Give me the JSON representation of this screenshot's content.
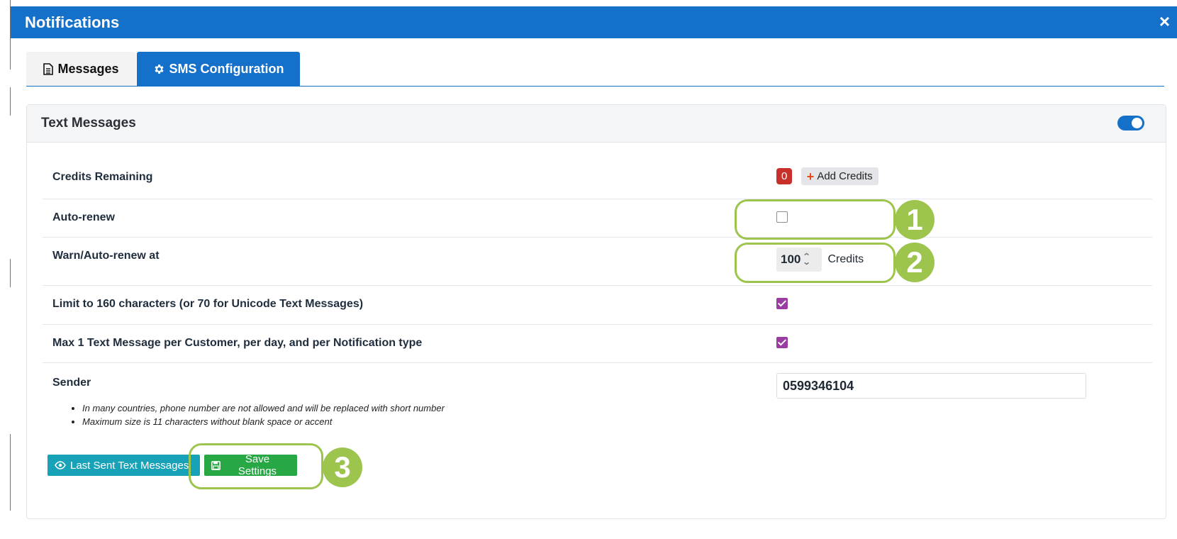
{
  "dialog": {
    "title": "Notifications",
    "close_label": "×"
  },
  "tabs": [
    {
      "label": "Messages",
      "icon": "document-icon",
      "active": false
    },
    {
      "label": "SMS Configuration",
      "icon": "gear-icon",
      "active": true
    }
  ],
  "card": {
    "title": "Text Messages",
    "enabled": true
  },
  "rows": {
    "credits_remaining": {
      "label": "Credits Remaining",
      "count": "0",
      "add_label": "Add Credits"
    },
    "auto_renew": {
      "label": "Auto-renew",
      "checked": false
    },
    "warn_at": {
      "label": "Warn/Auto-renew at",
      "value": "100",
      "unit": "Credits"
    },
    "limit_160": {
      "label": "Limit to 160 characters (or 70 for Unicode Text Messages)",
      "checked": true
    },
    "max_one": {
      "label": "Max 1 Text Message per Customer, per day, and per Notification type",
      "checked": true
    },
    "sender": {
      "label": "Sender",
      "value": "0599346104",
      "notes": [
        "In many countries, phone number are not allowed and will be replaced with short number",
        "Maximum size is 11 characters without blank space or accent"
      ]
    }
  },
  "buttons": {
    "last_sent": "Last Sent Text Messages",
    "save": "Save Settings"
  },
  "callouts": [
    "1",
    "2",
    "3"
  ],
  "colors": {
    "primary": "#1470c8",
    "danger": "#c9302c",
    "info": "#17a2b8",
    "success": "#28a745",
    "checkbox_checked": "#9b3ca3",
    "callout": "#9dc44d"
  }
}
